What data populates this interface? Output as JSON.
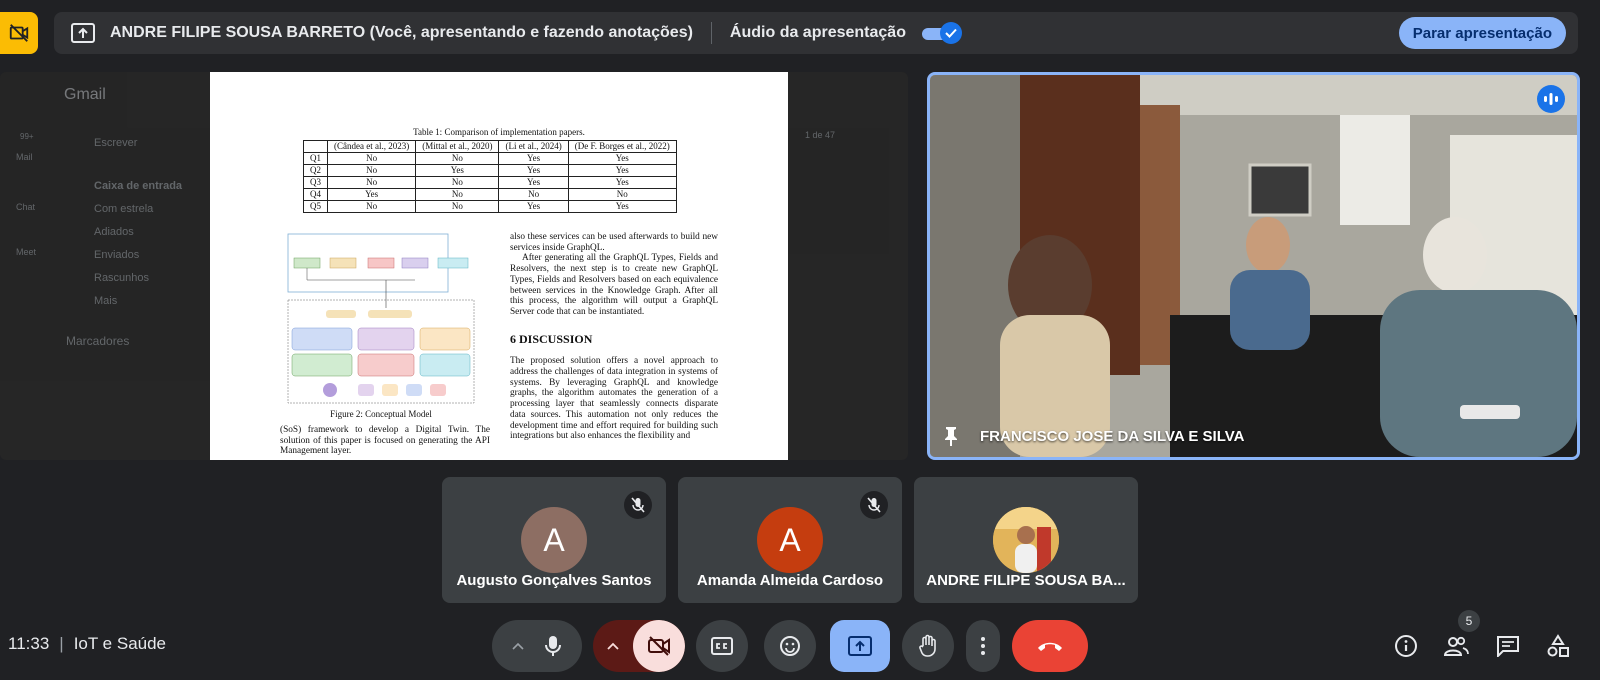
{
  "topbar": {
    "presenter_text": "ANDRE FILIPE SOUSA BARRETO (Você, apresentando e fazendo anotações)",
    "audio_label": "Áudio da apresentação",
    "audio_enabled": true,
    "stop_label": "Parar apresentação"
  },
  "document": {
    "table_caption": "Table 1: Comparison of implementation papers.",
    "table_headers": [
      "",
      "(Cândea et al., 2023)",
      "(Mittal et al., 2020)",
      "(Li et al., 2024)",
      "(De F. Borges et al., 2022)"
    ],
    "table_rows": [
      [
        "Q1",
        "No",
        "No",
        "Yes",
        "Yes"
      ],
      [
        "Q2",
        "No",
        "Yes",
        "Yes",
        "Yes"
      ],
      [
        "Q3",
        "No",
        "No",
        "Yes",
        "Yes"
      ],
      [
        "Q4",
        "Yes",
        "No",
        "No",
        "No"
      ],
      [
        "Q5",
        "No",
        "No",
        "Yes",
        "Yes"
      ]
    ],
    "figure_caption": "Figure 2: Conceptual Model",
    "left_text": "(SoS) framework to develop a Digital Twin. The solution of this paper is focused on generating the API Management layer.",
    "right_p1": "also these services can be used afterwards to build new services inside GraphQL.",
    "right_p2": "After generating all the GraphQL Types, Fields and Resolvers, the next step is to create new GraphQL Types, Fields and Resolvers based on each equivalence between services in the Knowledge Graph. After all this process, the algorithm will output a GraphQL Server code that can be instantiated.",
    "section_title": "6   DISCUSSION",
    "right_p3": "The proposed solution offers a novel approach to address the challenges of data integration in systems of systems. By leveraging GraphQL and knowledge graphs, the algorithm automates the generation of a processing layer that seamlessly connects disparate data sources. This automation not only reduces the development time and effort required for building such integrations but also enhances the flexibility and"
  },
  "gmail_background": {
    "logo": "Gmail",
    "compose": "Escrever",
    "items": [
      "Caixa de entrada",
      "Com estrela",
      "Adiados",
      "Enviados",
      "Rascunhos",
      "Mais"
    ],
    "labels_heading": "Marcadores",
    "rail": [
      "Mail",
      "Chat",
      "Meet"
    ],
    "badge": "99+",
    "pagination": "1 de 47"
  },
  "featured": {
    "name": "FRANCISCO JOSE DA SILVA E SILVA"
  },
  "participants": [
    {
      "initial": "A",
      "name": "Augusto Gonçalves Santos",
      "color": "#8d6e63",
      "muted": true
    },
    {
      "initial": "A",
      "name": "Amanda Almeida Cardoso",
      "color": "#c53d0f",
      "muted": true
    },
    {
      "initial": "",
      "name": "ANDRE FILIPE SOUSA BA...",
      "color": "#d9a441",
      "muted": false
    }
  ],
  "bottom": {
    "time": "11:33",
    "meeting_name": "IoT e Saúde",
    "people_count": "5"
  },
  "colors": {
    "accent": "#8ab4f8",
    "end_call": "#ea4335",
    "camera_off": "#f9dedc",
    "warning": "#fbbc04"
  }
}
